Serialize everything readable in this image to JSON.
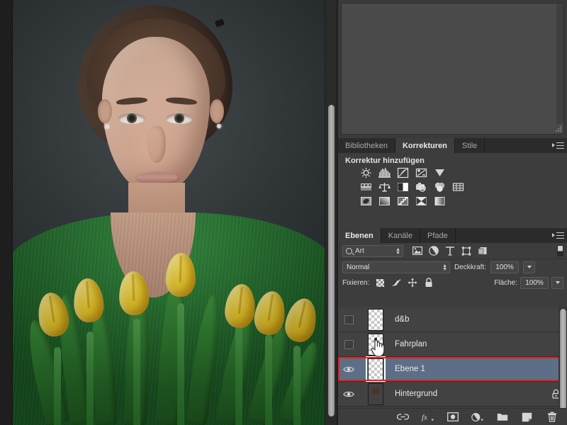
{
  "app": {
    "name": "Adobe Photoshop",
    "locale": "de"
  },
  "canvas": {
    "image_description": "Portrait of a woman holding a bouquet of yellow tulips, green garment, dark gray studio backdrop",
    "scrollbar": "vertical-scrollbar"
  },
  "dock": {
    "upper_panel": {
      "empty": true
    },
    "corrections_tabs": [
      {
        "label": "Bibliotheken",
        "active": false
      },
      {
        "label": "Korrekturen",
        "active": true
      },
      {
        "label": "Stile",
        "active": false
      }
    ],
    "corrections": {
      "title": "Korrektur hinzufügen",
      "icons": [
        [
          "brightness-contrast",
          "levels",
          "curves",
          "exposure",
          "vibrance"
        ],
        [
          "color-balance",
          "black-and-white",
          "hue-saturation",
          "photo-filter",
          "channel-mixer",
          "color-lookup"
        ],
        [
          "invert",
          "posterize",
          "threshold",
          "gradient-map",
          "selective-color"
        ]
      ]
    },
    "layers_tabs": [
      {
        "label": "Ebenen",
        "active": true
      },
      {
        "label": "Kanäle",
        "active": false
      },
      {
        "label": "Pfade",
        "active": false
      }
    ],
    "layers": {
      "filter": {
        "kind_label": "Art",
        "icons": [
          "pixel-filter-icon",
          "adjustment-filter-icon",
          "type-filter-icon",
          "shape-filter-icon",
          "smartobject-filter-icon"
        ],
        "toggle": "filter-toggle"
      },
      "blend_mode": "Normal",
      "opacity_label": "Deckkraft:",
      "opacity_value": "100%",
      "lock_label": "Fixieren:",
      "lock_icons": [
        "lock-transparent-pixels",
        "lock-image-pixels",
        "lock-position",
        "lock-all"
      ],
      "fill_label": "Fläche:",
      "fill_value": "100%",
      "rows": [
        {
          "name": "d&b",
          "visible": false,
          "selected": false,
          "locked": false,
          "thumb": "empty"
        },
        {
          "name": "Fahrplan",
          "visible": false,
          "selected": false,
          "locked": false,
          "thumb": "sketch"
        },
        {
          "name": "Ebene 1",
          "visible": true,
          "selected": true,
          "locked": false,
          "thumb": "empty"
        },
        {
          "name": "Hintergrund",
          "visible": true,
          "selected": false,
          "locked": true,
          "thumb": "photo"
        }
      ],
      "highlight_color": "#ee1c1c",
      "selected_row_color": "#5d6f86",
      "toolbar_icons": [
        "link-icon",
        "fx-icon",
        "add-mask-icon",
        "adjustment-layer-icon",
        "new-group-icon",
        "new-layer-icon",
        "delete-layer-icon"
      ]
    }
  },
  "cursor": {
    "type": "pointing-hand-cursor"
  }
}
